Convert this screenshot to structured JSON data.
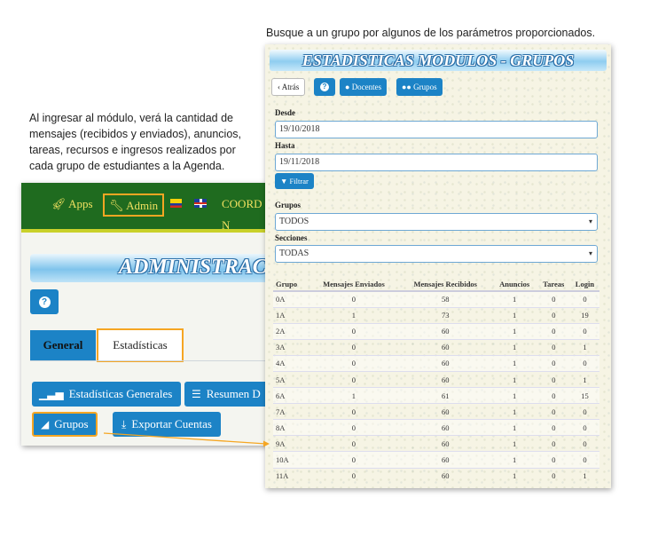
{
  "captions": {
    "top": "Busque a un grupo por algunos de los parámetros proporcionados.",
    "left": "Al ingresar al módulo, verá la cantidad de mensajes (recibidos y enviados),  anuncios, tareas, recursos e ingresos realizados por cada grupo de estudiantes a la Agenda."
  },
  "left_screen": {
    "nav": {
      "apps": "Apps",
      "admin": "Admin",
      "coord": "COORD N"
    },
    "banner": "ADMINISTRACI",
    "tabs": {
      "general": "General",
      "estadisticas": "Estadísticas"
    },
    "buttons": {
      "estadisticas_generales": "Estadísticas Generales",
      "resumen": "Resumen D",
      "grupos": "Grupos",
      "exportar": "Exportar Cuentas"
    }
  },
  "right_screen": {
    "title": "ESTADISTICAS MODULOS - GRUPOS",
    "toolbar": {
      "back": "Atrás",
      "docentes": "Docentes",
      "grupos": "Grupos"
    },
    "filters": {
      "desde_label": "Desde",
      "desde_value": "19/10/2018",
      "hasta_label": "Hasta",
      "hasta_value": "19/11/2018",
      "filtrar": "Filtrar",
      "grupos_label": "Grupos",
      "grupos_value": "TODOS",
      "secciones_label": "Secciones",
      "secciones_value": "TODAS"
    },
    "table": {
      "headers": [
        "Grupo",
        "Mensajes Enviados",
        "Mensajes Recibidos",
        "Anuncios",
        "Tareas",
        "Login"
      ],
      "rows": [
        [
          "0A",
          "0",
          "58",
          "1",
          "0",
          "0"
        ],
        [
          "1A",
          "1",
          "73",
          "1",
          "0",
          "19"
        ],
        [
          "2A",
          "0",
          "60",
          "1",
          "0",
          "0"
        ],
        [
          "3A",
          "0",
          "60",
          "1",
          "0",
          "1"
        ],
        [
          "4A",
          "0",
          "60",
          "1",
          "0",
          "0"
        ],
        [
          "5A",
          "0",
          "60",
          "1",
          "0",
          "1"
        ],
        [
          "6A",
          "1",
          "61",
          "1",
          "0",
          "15"
        ],
        [
          "7A",
          "0",
          "60",
          "1",
          "0",
          "0"
        ],
        [
          "8A",
          "0",
          "60",
          "1",
          "0",
          "0"
        ],
        [
          "9A",
          "0",
          "60",
          "1",
          "0",
          "0"
        ],
        [
          "10A",
          "0",
          "60",
          "1",
          "0",
          "0"
        ],
        [
          "11A",
          "0",
          "60",
          "1",
          "0",
          "1"
        ]
      ]
    }
  },
  "colors": {
    "accent_blue": "#1c83c6",
    "highlight_orange": "#f5a623",
    "nav_green": "#1f6b1f"
  }
}
